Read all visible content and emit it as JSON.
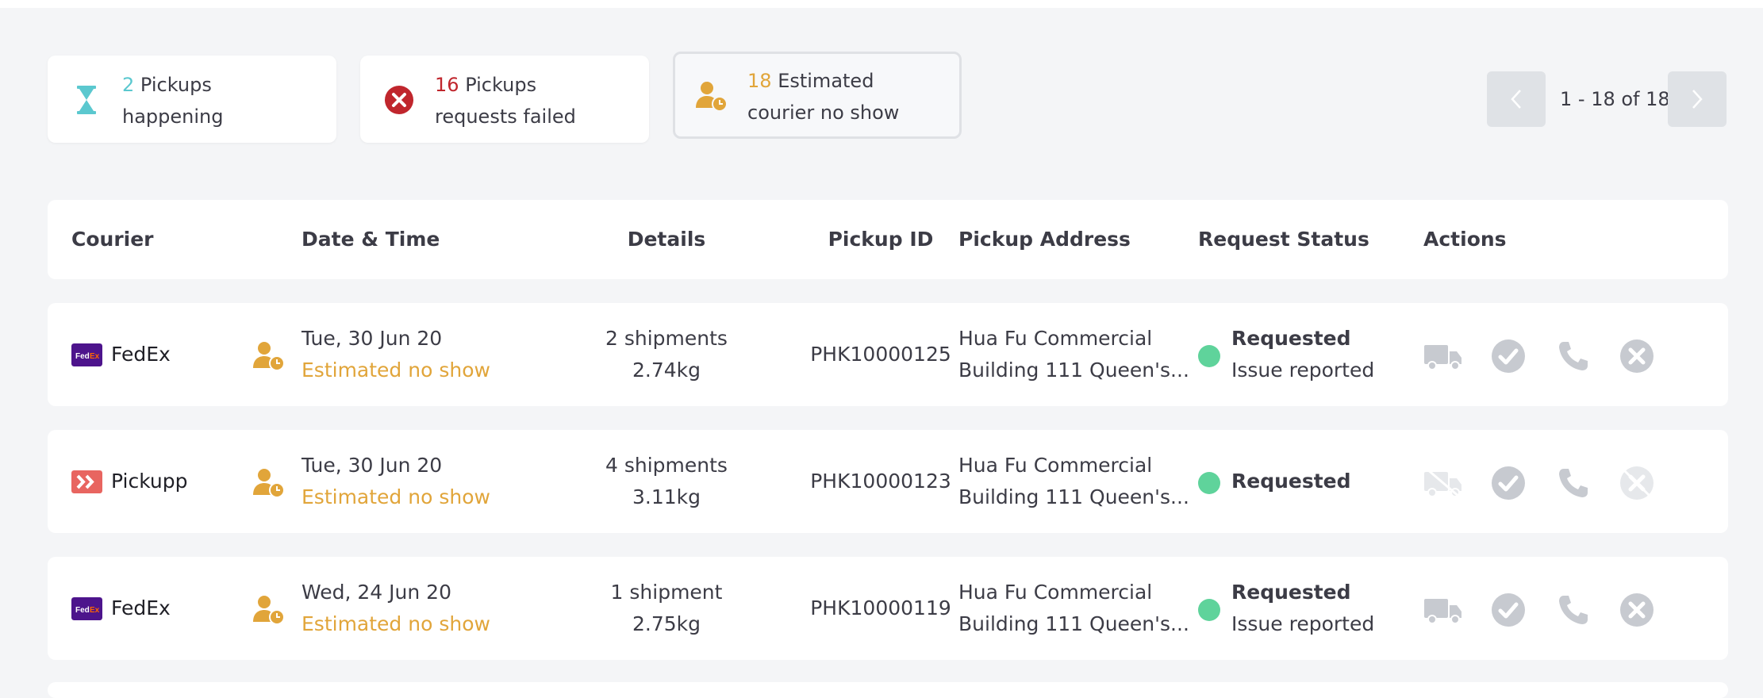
{
  "summary": {
    "happening": {
      "count": "2",
      "label": "Pickups",
      "label2": "happening",
      "color": "#5bc8cf"
    },
    "failed": {
      "count": "16",
      "label": "Pickups",
      "label2": "requests failed",
      "color": "#c0262d"
    },
    "noshow": {
      "count": "18",
      "label": "Estimated",
      "label2": "courier no show",
      "color": "#e1a53a"
    }
  },
  "pagination": {
    "range_text": "1 - 18 of 18"
  },
  "table": {
    "headers": {
      "courier": "Courier",
      "datetime": "Date & Time",
      "details": "Details",
      "pickup_id": "Pickup ID",
      "address": "Pickup Address",
      "status": "Request Status",
      "actions": "Actions"
    },
    "rows": [
      {
        "courier": "FedEx",
        "courier_logo": "fedex-logo",
        "date": "Tue, 30 Jun 20",
        "estimate": "Estimated no show",
        "shipments": "2 shipments",
        "weight": "2.74kg",
        "pickup_id": "PHK10000125",
        "address1": "Hua Fu Commercial",
        "address2": "Building 111 Queen's...",
        "status": "Requested",
        "status_note": "Issue reported",
        "actions_enabled": true
      },
      {
        "courier": "Pickupp",
        "courier_logo": "pickupp-logo",
        "date": "Tue, 30 Jun 20",
        "estimate": "Estimated no show",
        "shipments": "4 shipments",
        "weight": "3.11kg",
        "pickup_id": "PHK10000123",
        "address1": "Hua Fu Commercial",
        "address2": "Building 111 Queen's...",
        "status": "Requested",
        "status_note": "",
        "actions_enabled": false
      },
      {
        "courier": "FedEx",
        "courier_logo": "fedex-logo",
        "date": "Wed, 24 Jun 20",
        "estimate": "Estimated no show",
        "shipments": "1 shipment",
        "weight": "2.75kg",
        "pickup_id": "PHK10000119",
        "address1": "Hua Fu Commercial",
        "address2": "Building 111 Queen's...",
        "status": "Requested",
        "status_note": "Issue reported",
        "actions_enabled": true
      }
    ]
  },
  "colors": {
    "accent_warning": "#e1a53a",
    "status_green": "#5fd39b",
    "icon_gray": "#c7cad0",
    "icon_gray_light": "#e6e8eb"
  }
}
